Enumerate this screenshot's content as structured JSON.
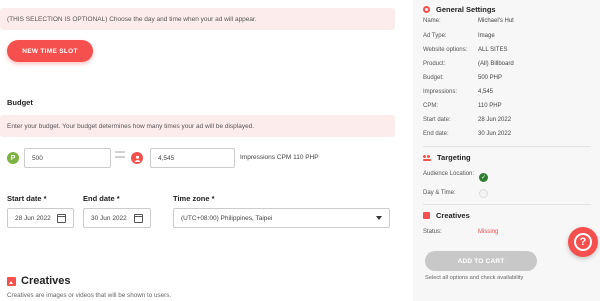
{
  "schedule": {
    "optional_note": "(THIS SELECTION IS OPTIONAL) Choose the day and time when your ad will appear.",
    "new_time_slot_label": "NEW TIME SLOT"
  },
  "budget": {
    "heading": "Budget",
    "note": "Enter your budget. Your budget determines how many times your ad will be displayed.",
    "budget_value": "500",
    "budget_icon_letter": "P",
    "impressions_value": "4,545",
    "impressions_cpm_text": "Impressions CPM  110 PHP"
  },
  "dates": {
    "start_label": "Start date *",
    "start_value": "28 Jun 2022",
    "end_label": "End date *",
    "end_value": "30 Jun 2022",
    "timezone_label": "Time zone *",
    "timezone_value": "(UTC+08:00) Philippines, Taipei"
  },
  "creatives": {
    "heading": "Creatives",
    "subtext": "Creatives are images or videos that will be shown to users."
  },
  "summary": {
    "general_heading": "General Settings",
    "general_rows": [
      {
        "k": "Name:",
        "v": "Michael's Hut"
      },
      {
        "k": "Ad Type:",
        "v": "Image"
      },
      {
        "k": "Website options:",
        "v": "ALL SITES"
      },
      {
        "k": "Product:",
        "v": "(All) Billboard"
      },
      {
        "k": "Budget:",
        "v": "500 PHP"
      },
      {
        "k": "Impressions:",
        "v": "4,545"
      },
      {
        "k": "CPM:",
        "v": "110 PHP"
      },
      {
        "k": "Start date:",
        "v": "28 Jun 2022"
      },
      {
        "k": "End date:",
        "v": "30 Jun 2022"
      }
    ],
    "targeting_heading": "Targeting",
    "audience_location_label": "Audience Location:",
    "day_time_label": "Day & Time:",
    "creatives_heading": "Creatives",
    "status_label": "Status:",
    "status_value": "Missing",
    "add_to_cart_label": "ADD TO CART",
    "cart_hint": "Select all options and check availability"
  },
  "help_icon_glyph": "?"
}
